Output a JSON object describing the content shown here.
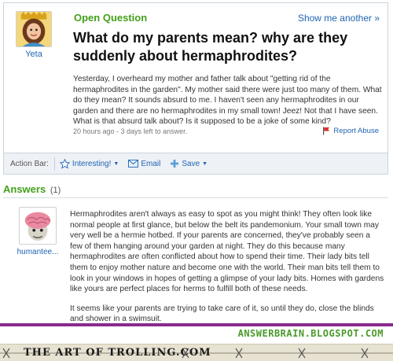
{
  "question": {
    "type_label": "Open Question",
    "show_more_label": "Show me another »",
    "asker_name": "Yeta",
    "title": "What do my parents mean? why are they suddenly about hermaphrodites?",
    "body": "Yesterday, I overheard my mother and father talk about \"getting rid of the hermaphrodites in the garden\". My mother said there were just too many of them. What do they mean? It sounds absurd to me. I haven't seen any hermaphrodites in our garden and there are no hermaphrodites in my small town! Jeez! Not that I have seen. What is that absurd talk about? Is it supposed to be a joke of some kind?",
    "meta": "20 hours ago - 3 days left to answer.",
    "report_label": "Report Abuse"
  },
  "action_bar": {
    "label": "Action Bar:",
    "interesting_label": "Interesting!",
    "email_label": "Email",
    "save_label": "Save"
  },
  "answers": {
    "title": "Answers",
    "count": "(1)",
    "items": [
      {
        "author": "humantee...",
        "paragraphs": [
          "Hermaphrodites aren't always as easy to spot as you might think! They often look like normal people at first glance, but below the belt its pandemonium. Your small town may very well be a hermie hotbed. If your parents are concerned, they've probably seen a few of them hanging around your garden at night. They do this because many hermaphrodites are often conflicted about how to spend their time. Their lady bits tell them to enjoy mother nature and become one with the world. Their man bits tell them to look in your windows in hopes of getting a glimpse of your lady bits. Homes with gardens like yours are perfect places for herms to fulfill both of these needs.",
          "It seems like your parents are trying to take care of it, so until they do, close the blinds and shower in a swimsuit."
        ]
      }
    ]
  },
  "credits": {
    "blog": "ANSWERBRAIN.BLOGSPOT.COM",
    "site": "THE ART OF TROLLING.COM"
  },
  "colors": {
    "accent_green": "#43a01a",
    "link_blue": "#1f64b3",
    "divider_purple": "#8a2a8f"
  }
}
